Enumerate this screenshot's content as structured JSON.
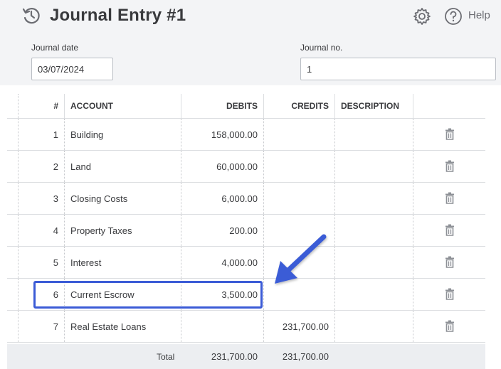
{
  "header": {
    "title": "Journal Entry #1",
    "help_label": "Help"
  },
  "form": {
    "journal_date_label": "Journal date",
    "journal_date_value": "03/07/2024",
    "journal_no_label": "Journal no.",
    "journal_no_value": "1"
  },
  "table": {
    "columns": {
      "num": "#",
      "account": "ACCOUNT",
      "debits": "DEBITS",
      "credits": "CREDITS",
      "description": "DESCRIPTION"
    },
    "rows": [
      {
        "num": "1",
        "account": "Building",
        "debits": "158,000.00",
        "credits": "",
        "description": ""
      },
      {
        "num": "2",
        "account": "Land",
        "debits": "60,000.00",
        "credits": "",
        "description": ""
      },
      {
        "num": "3",
        "account": "Closing Costs",
        "debits": "6,000.00",
        "credits": "",
        "description": ""
      },
      {
        "num": "4",
        "account": "Property Taxes",
        "debits": "200.00",
        "credits": "",
        "description": ""
      },
      {
        "num": "5",
        "account": "Interest",
        "debits": "4,000.00",
        "credits": "",
        "description": ""
      },
      {
        "num": "6",
        "account": "Current Escrow",
        "debits": "3,500.00",
        "credits": "",
        "description": ""
      },
      {
        "num": "7",
        "account": "Real Estate Loans",
        "debits": "",
        "credits": "231,700.00",
        "description": ""
      }
    ],
    "total": {
      "label": "Total",
      "debits": "231,700.00",
      "credits": "231,700.00"
    }
  },
  "annotation": {
    "highlight_color": "#3b5bd6",
    "arrow_color": "#3b5bd6"
  },
  "icons": [
    "history-icon",
    "gear-icon",
    "help-icon",
    "trash-icon"
  ]
}
